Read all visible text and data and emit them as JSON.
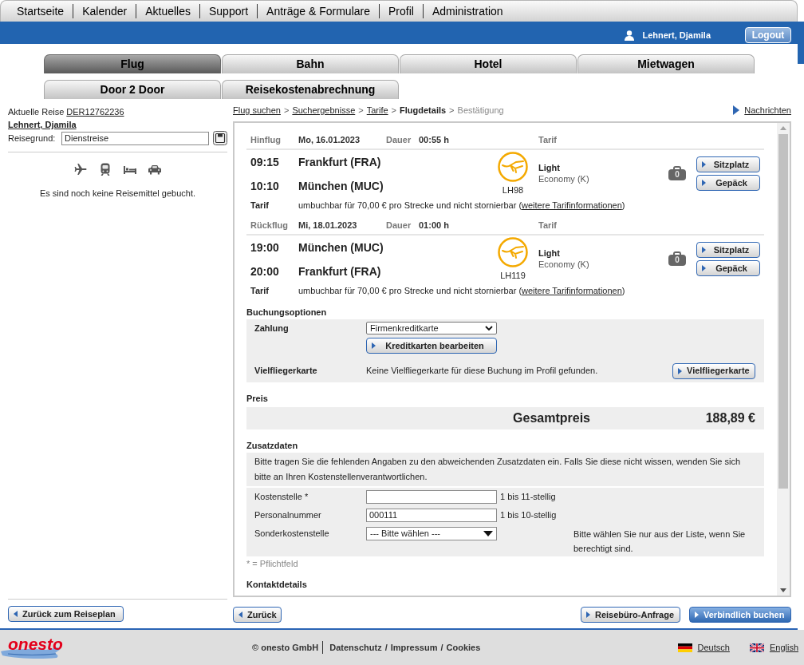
{
  "top_nav": [
    {
      "label": "Startseite"
    },
    {
      "label": "Kalender"
    },
    {
      "label": "Aktuelles"
    },
    {
      "label": "Support"
    },
    {
      "label": "Anträge & Formulare"
    },
    {
      "label": "Profil"
    },
    {
      "label": "Administration"
    }
  ],
  "user_bar": {
    "user_name": "Lehnert, Djamila",
    "logout": "Logout"
  },
  "tabs": [
    {
      "label": "Flug",
      "selected": true
    },
    {
      "label": "Bahn",
      "selected": false
    },
    {
      "label": "Hotel",
      "selected": false
    },
    {
      "label": "Mietwagen",
      "selected": false
    },
    {
      "label": "Door 2 Door",
      "selected": false
    },
    {
      "label": "Reisekostenabrechnung",
      "selected": false
    }
  ],
  "sidebar": {
    "trip_label": "Aktuelle Reise",
    "trip_number": "DER12762236",
    "traveler": "Lehnert, Djamila",
    "reason_label": "Reisegrund:",
    "reason_value": "Dienstreise",
    "empty_message": "Es sind noch keine Reisemittel gebucht.",
    "back_button": "Zurück zum Reiseplan"
  },
  "breadcrumb": {
    "separator": ">",
    "steps": [
      {
        "label": "Flug suchen",
        "kind": "link"
      },
      {
        "label": "Suchergebnisse",
        "kind": "link"
      },
      {
        "label": "Tarife",
        "kind": "link"
      },
      {
        "label": "Flugdetails",
        "kind": "current"
      },
      {
        "label": "Bestätigung",
        "kind": "upcoming"
      }
    ]
  },
  "messages_link": "Nachrichten",
  "flights": [
    {
      "direction": "Hinflug",
      "date": "Mo, 16.01.2023",
      "duration_label": "Dauer",
      "duration": "00:55 h",
      "fare_header": "Tarif",
      "segments": [
        {
          "time": "09:15",
          "airport": "Frankfurt (FRA)"
        },
        {
          "time": "10:10",
          "airport": "München (MUC)"
        }
      ],
      "flight_number": "LH98",
      "fare": "Light",
      "cabin": "Economy (K)",
      "baggage_count": "0",
      "seat_button": "Sitzplatz",
      "baggage_button": "Gepäck",
      "tariff_label": "Tarif",
      "tariff_note": "umbuchbar für 70,00 € pro Strecke und nicht stornierbar (",
      "tariff_link": "weitere Tarifinformationen",
      "tariff_note_end": ")"
    },
    {
      "direction": "Rückflug",
      "date": "Mi, 18.01.2023",
      "duration_label": "Dauer",
      "duration": "01:00 h",
      "fare_header": "Tarif",
      "segments": [
        {
          "time": "19:00",
          "airport": "München (MUC)"
        },
        {
          "time": "20:00",
          "airport": "Frankfurt (FRA)"
        }
      ],
      "flight_number": "LH119",
      "fare": "Light",
      "cabin": "Economy (K)",
      "baggage_count": "0",
      "seat_button": "Sitzplatz",
      "baggage_button": "Gepäck",
      "tariff_label": "Tarif",
      "tariff_note": "umbuchbar für 70,00 € pro Strecke und nicht stornierbar (",
      "tariff_link": "weitere Tarifinformationen",
      "tariff_note_end": ")"
    }
  ],
  "booking_options": {
    "title": "Buchungsoptionen",
    "payment_label": "Zahlung",
    "payment_value": "Firmenkreditkarte",
    "edit_cards_button": "Kreditkarten bearbeiten",
    "frequent_flyer_label": "Vielfliegerkarte",
    "frequent_flyer_note": "Keine Vielfliegerkarte für diese Buchung im Profil gefunden.",
    "frequent_flyer_button": "Vielfliegerkarte"
  },
  "price": {
    "title": "Preis",
    "total_label": "Gesamtpreis",
    "total": "188,89 €"
  },
  "additional_data": {
    "title": "Zusatzdaten",
    "notice": "Bitte tragen Sie die fehlenden Angaben zu den abweichenden Zusatzdaten ein. Falls Sie diese nicht wissen, wenden Sie sich bitte an Ihren Kostenstellenverantwortlichen.",
    "fields": [
      {
        "kind": "text",
        "label": "Kostenstelle *",
        "hint": "1 bis 11-stellig"
      },
      {
        "kind": "text",
        "label": "Personalnummer",
        "value": "000111",
        "hint": "1 bis 10-stellig"
      },
      {
        "kind": "select",
        "label": "Sonderkostenstelle",
        "value": "--- Bitte wählen ---",
        "hint": "Bitte wählen Sie nur aus der Liste, wenn Sie berechtigt sind."
      }
    ],
    "required_note": "* = Pflichtfeld"
  },
  "contact_details": {
    "title": "Kontaktdetails"
  },
  "actions": {
    "back": "Zurück",
    "agency_request": "Reisebüro-Anfrage",
    "book": "Verbindlich buchen"
  },
  "footer": {
    "logo": "onesto",
    "copyright": "© onesto GmbH",
    "legal_separator": "/",
    "legal_links": [
      "Datenschutz",
      "Impressum",
      "Cookies"
    ],
    "languages": [
      {
        "label": "Deutsch",
        "kind": "de"
      },
      {
        "label": "English",
        "kind": "en"
      }
    ]
  }
}
